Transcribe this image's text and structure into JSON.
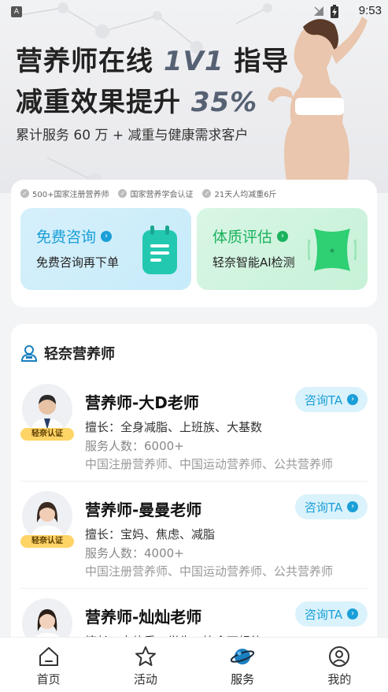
{
  "status_bar": {
    "time": "9:53",
    "indicator": "A"
  },
  "hero": {
    "title_line1_text": "营养师在线",
    "title_line1_highlight": "1V1",
    "title_line1_tail": "指导",
    "title_line2_text": "减重效果提升",
    "title_line2_highlight": "35%",
    "subtitle": "累计服务 60 万 + 减重与健康需求客户"
  },
  "certs": [
    {
      "label": "500+国家注册营养师"
    },
    {
      "label": "国家营养学会认证"
    },
    {
      "label": "21天人均减重6斤"
    }
  ],
  "tiles": {
    "free": {
      "title": "免费咨询",
      "subtitle": "免费咨询再下单",
      "icon": "notepad-icon"
    },
    "assess": {
      "title": "体质评估",
      "subtitle": "轻奈智能AI检测",
      "icon": "body-waist-icon"
    }
  },
  "list": {
    "title": "轻奈营养师",
    "consult_label": "咨询TA",
    "badge_label": "轻奈认证",
    "items": [
      {
        "name": "营养师-大D老师",
        "specialty": "擅长：全身减脂、上班族、大基数",
        "count": "服务人数：6000+",
        "certs": "中国注册营养师、中国运动营养师、公共营养师"
      },
      {
        "name": "营养师-曼曼老师",
        "specialty": "擅长：宝妈、焦虑、减脂",
        "count": "服务人数：4000+",
        "certs": "中国注册营养师、中国运动营养师、公共营养师"
      },
      {
        "name": "营养师-灿灿老师",
        "specialty": "擅长：大体重、学生、饮食不规律",
        "count": "",
        "certs": ""
      }
    ]
  },
  "bottom_nav": [
    {
      "label": "首页",
      "icon": "home-icon"
    },
    {
      "label": "活动",
      "icon": "star-icon"
    },
    {
      "label": "服务",
      "icon": "planet-icon"
    },
    {
      "label": "我的",
      "icon": "profile-icon"
    }
  ],
  "colors": {
    "accent_blue": "#1a9fd8",
    "accent_green": "#1bb25e",
    "badge_yellow": "#ffd466"
  }
}
